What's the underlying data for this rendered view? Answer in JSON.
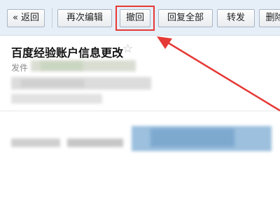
{
  "toolbar": {
    "back_label": "« 返回",
    "reedit_label": "再次编辑",
    "recall_label": "撤回",
    "reply_all_label": "回复全部",
    "forward_label": "转发",
    "delete_label": "删除"
  },
  "message": {
    "subject": "百度经验账户信息更改",
    "star": "☆",
    "sender_label": "发件"
  },
  "colors": {
    "toolbar_bg": "#e6eef7",
    "highlight": "#e53935",
    "arrow": "#e53935"
  }
}
